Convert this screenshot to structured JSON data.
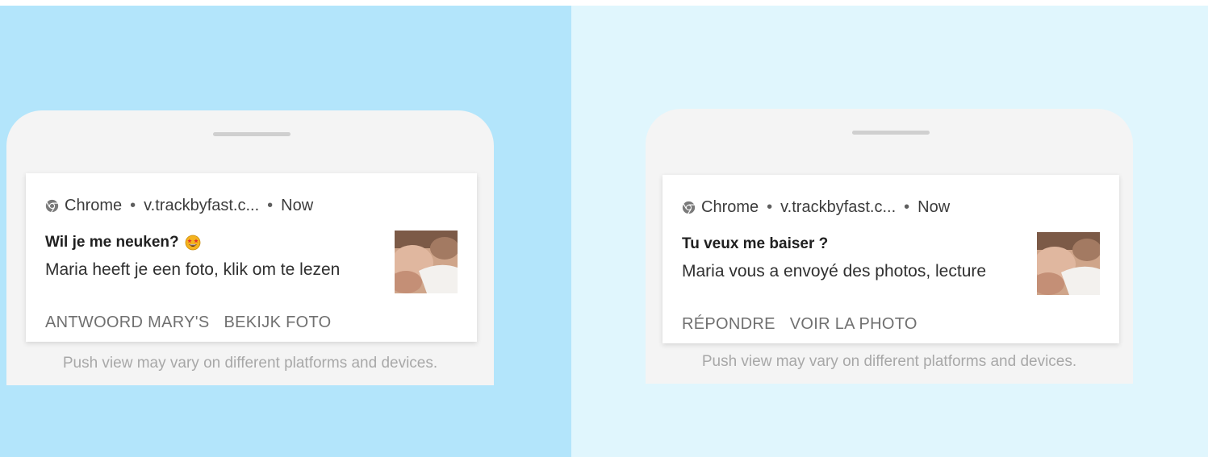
{
  "colors": {
    "left_background": "#b3e5fb",
    "right_background": "#e0f6fd",
    "phone_background": "#f4f4f4",
    "card_background": "#ffffff",
    "action_text": "#707070",
    "disclaimer_text": "#a8a8a8"
  },
  "notifications": [
    {
      "app_icon": "chrome-icon",
      "app_name": "Chrome",
      "separator": "•",
      "site": "v.trackbyfast.c...",
      "time": "Now",
      "title": "Wil je me neuken?",
      "title_emoji": "star-struck-emoji-icon",
      "body": "Maria heeft je een foto, klik om te lezen",
      "thumbnail": "photo-thumbnail",
      "actions": [
        "ANTWOORD MARY'S",
        "BEKIJK FOTO"
      ],
      "disclaimer": "Push view may vary on different platforms and devices."
    },
    {
      "app_icon": "chrome-icon",
      "app_name": "Chrome",
      "separator": "•",
      "site": "v.trackbyfast.c...",
      "time": "Now",
      "title": "Tu veux me baiser ?",
      "body": "Maria vous a envoyé des photos, lecture",
      "thumbnail": "photo-thumbnail",
      "actions": [
        "RÉPONDRE",
        "VOIR LA PHOTO"
      ],
      "disclaimer": "Push view may vary on different platforms and devices."
    }
  ]
}
